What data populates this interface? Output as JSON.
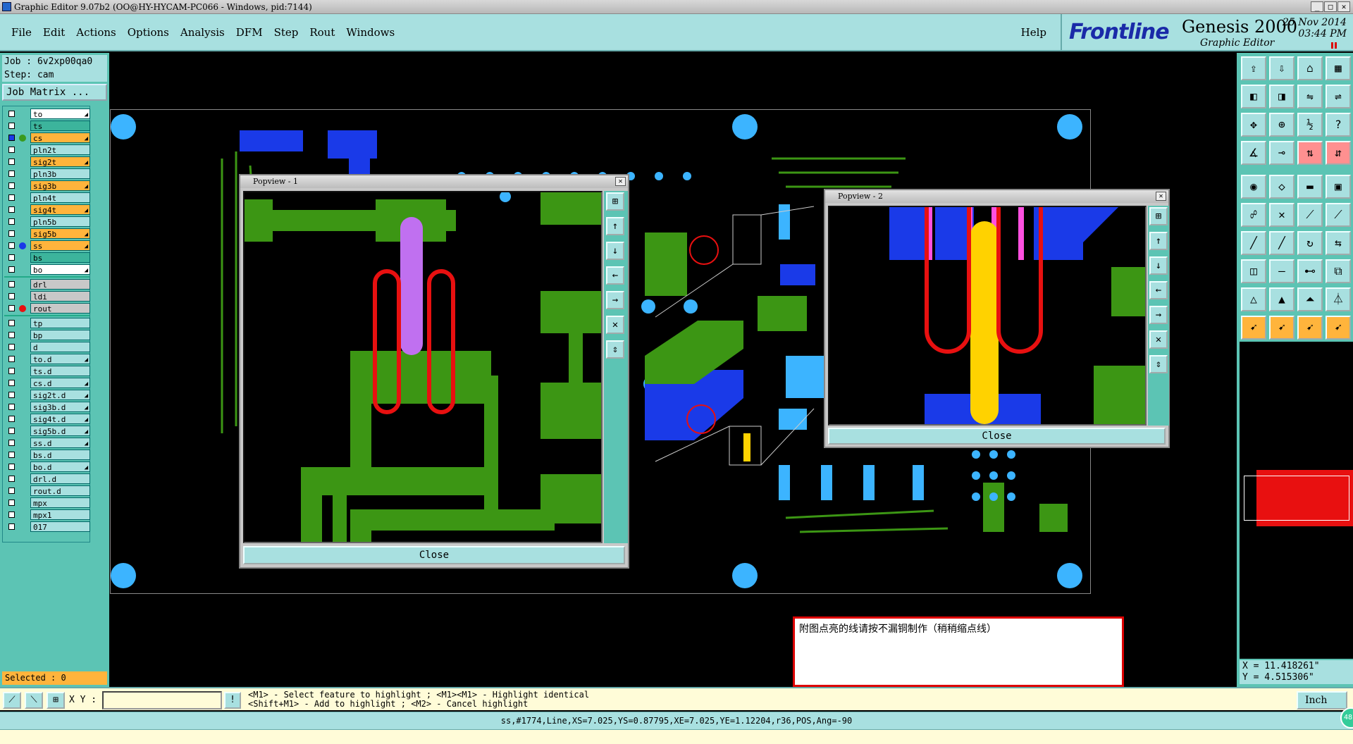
{
  "window": {
    "title": "Graphic Editor 9.07b2 (OO@HY-HYCAM-PC066 - Windows, pid:7144)",
    "minimize": "_",
    "maximize": "□",
    "close": "✕"
  },
  "menu": {
    "items": [
      "File",
      "Edit",
      "Actions",
      "Options",
      "Analysis",
      "DFM",
      "Step",
      "Rout",
      "Windows"
    ],
    "help": "Help"
  },
  "brand": {
    "logo": "Frontline",
    "product": "Genesis 2000",
    "subtitle": "Graphic Editor",
    "date": "25 Nov 2014",
    "time": "03:44 PM"
  },
  "job": {
    "job_line": "Job : 6v2xp00qa0",
    "step_line": "Step: cam",
    "matrix_button": "Job Matrix ..."
  },
  "layers": [
    {
      "name": "to",
      "bg": "#ffffff",
      "arrow": true,
      "dot": ""
    },
    {
      "name": "ts",
      "bg": "#3cb49c",
      "arrow": false,
      "dot": ""
    },
    {
      "name": "cs",
      "bg": "#ffb43c",
      "arrow": true,
      "dot": "#3a9a1e",
      "active": true
    },
    {
      "name": "pln2t",
      "bg": "#a8e0e0",
      "arrow": false,
      "dot": ""
    },
    {
      "name": "sig2t",
      "bg": "#ffb43c",
      "arrow": true,
      "dot": ""
    },
    {
      "name": "pln3b",
      "bg": "#a8e0e0",
      "arrow": false,
      "dot": ""
    },
    {
      "name": "sig3b",
      "bg": "#ffb43c",
      "arrow": true,
      "dot": ""
    },
    {
      "name": "pln4t",
      "bg": "#a8e0e0",
      "arrow": false,
      "dot": ""
    },
    {
      "name": "sig4t",
      "bg": "#ffb43c",
      "arrow": true,
      "dot": ""
    },
    {
      "name": "pln5b",
      "bg": "#a8e0e0",
      "arrow": false,
      "dot": ""
    },
    {
      "name": "sig5b",
      "bg": "#ffb43c",
      "arrow": true,
      "dot": ""
    },
    {
      "name": "ss",
      "bg": "#ffb43c",
      "arrow": true,
      "dot": "#1a3ae8"
    },
    {
      "name": "bs",
      "bg": "#3cb49c",
      "arrow": false,
      "dot": ""
    },
    {
      "name": "bo",
      "bg": "#ffffff",
      "arrow": true,
      "dot": ""
    },
    {
      "name": "drl",
      "bg": "#c8c8c8",
      "arrow": false,
      "dot": "",
      "sep": true
    },
    {
      "name": "ldi",
      "bg": "#c8c8c8",
      "arrow": false,
      "dot": ""
    },
    {
      "name": "rout",
      "bg": "#c8c8c8",
      "arrow": false,
      "dot": "#e81010"
    },
    {
      "name": "tp",
      "bg": "#a8e0e0",
      "arrow": false,
      "dot": "",
      "sep": true
    },
    {
      "name": "bp",
      "bg": "#a8e0e0",
      "arrow": false,
      "dot": ""
    },
    {
      "name": "d",
      "bg": "#a8e0e0",
      "arrow": false,
      "dot": ""
    },
    {
      "name": "to.d",
      "bg": "#a8e0e0",
      "arrow": true,
      "dot": ""
    },
    {
      "name": "ts.d",
      "bg": "#a8e0e0",
      "arrow": false,
      "dot": ""
    },
    {
      "name": "cs.d",
      "bg": "#a8e0e0",
      "arrow": true,
      "dot": ""
    },
    {
      "name": "sig2t.d",
      "bg": "#a8e0e0",
      "arrow": true,
      "dot": ""
    },
    {
      "name": "sig3b.d",
      "bg": "#a8e0e0",
      "arrow": true,
      "dot": ""
    },
    {
      "name": "sig4t.d",
      "bg": "#a8e0e0",
      "arrow": true,
      "dot": ""
    },
    {
      "name": "sig5b.d",
      "bg": "#a8e0e0",
      "arrow": true,
      "dot": ""
    },
    {
      "name": "ss.d",
      "bg": "#a8e0e0",
      "arrow": true,
      "dot": ""
    },
    {
      "name": "bs.d",
      "bg": "#a8e0e0",
      "arrow": false,
      "dot": ""
    },
    {
      "name": "bo.d",
      "bg": "#a8e0e0",
      "arrow": true,
      "dot": ""
    },
    {
      "name": "drl.d",
      "bg": "#a8e0e0",
      "arrow": false,
      "dot": ""
    },
    {
      "name": "rout.d",
      "bg": "#a8e0e0",
      "arrow": false,
      "dot": ""
    },
    {
      "name": "mpx",
      "bg": "#a8e0e0",
      "arrow": false,
      "dot": ""
    },
    {
      "name": "mpx1",
      "bg": "#a8e0e0",
      "arrow": false,
      "dot": ""
    },
    {
      "name": "017",
      "bg": "#a8e0e0",
      "arrow": false,
      "dot": ""
    }
  ],
  "selected": "Selected : 0",
  "popview1": {
    "title": "Popview - 1",
    "close": "Close"
  },
  "popview2": {
    "title": "Popview - 2",
    "close": "Close"
  },
  "note": "附图点亮的线请按不漏铜制作（稍稍缩点线）",
  "coords": {
    "x": "X = 11.418261\"",
    "y": "Y = 4.515306\""
  },
  "status": {
    "xy_label": "X Y :",
    "xy_value": "",
    "hint1": "<M1> - Select feature to highlight ; <M1><M1> - Highlight identical",
    "hint2": "<Shift+M1> - Add to highlight ; <M2> - Cancel highlight",
    "unit": "Inch"
  },
  "info": "ss,#1774,Line,XS=7.025,YS=0.87795,XE=7.025,YE=1.12204,r36,POS,Ang=-90",
  "badge": "48",
  "colors": {
    "panel": "#5cc4b4",
    "light": "#a8e0e0",
    "highlight": "#ffb43c",
    "copper": "#3c9614",
    "blue": "#1a3ae8",
    "cyan": "#3cb4ff"
  }
}
